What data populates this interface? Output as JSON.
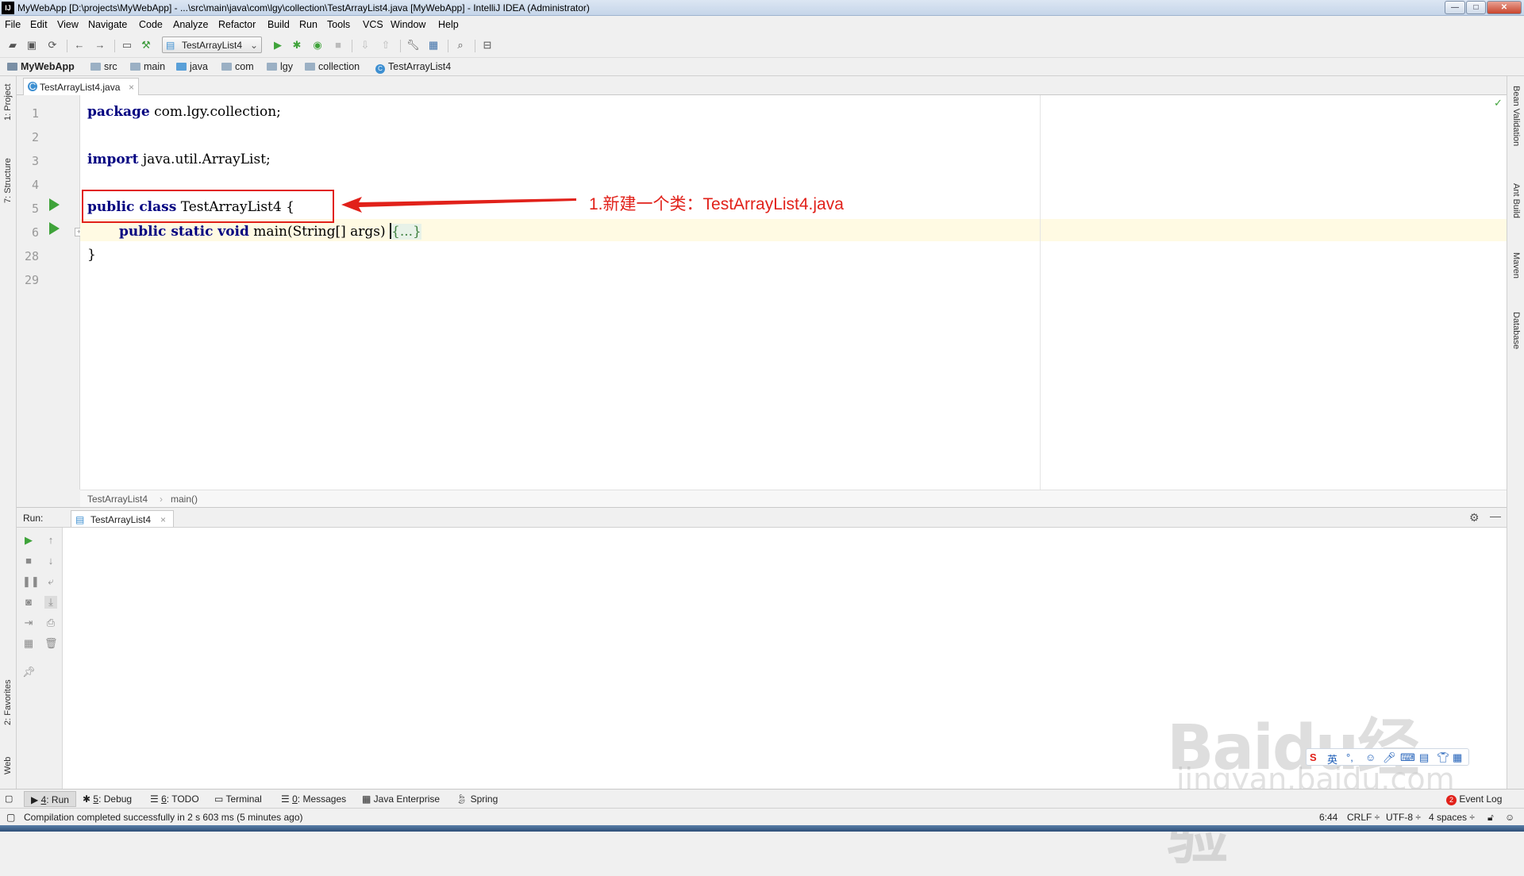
{
  "window": {
    "title": "MyWebApp [D:\\projects\\MyWebApp] - ...\\src\\main\\java\\com\\lgy\\collection\\TestArrayList4.java [MyWebApp] - IntelliJ IDEA (Administrator)",
    "app_icon": "IJ",
    "minimize": "—",
    "maximize": "□",
    "close": "✕"
  },
  "menu": [
    "File",
    "Edit",
    "View",
    "Navigate",
    "Code",
    "Analyze",
    "Refactor",
    "Build",
    "Run",
    "Tools",
    "VCS",
    "Window",
    "Help"
  ],
  "toolbar": {
    "run_config": "TestArrayList4",
    "icons": [
      "open-icon",
      "save-icon",
      "sync-icon",
      "back-icon",
      "forward-icon",
      "project-structure-icon",
      "build-icon",
      "run-icon",
      "debug-icon",
      "coverage-icon",
      "stop-icon",
      "vcs-update-icon",
      "vcs-commit-icon",
      "settings-icon",
      "sdk-icon",
      "search-icon",
      "terminal-icon"
    ]
  },
  "breadcrumbs": {
    "project": "MyWebApp",
    "items": [
      "src",
      "main",
      "java",
      "com",
      "lgy",
      "collection",
      "TestArrayList4"
    ]
  },
  "left_tool_windows": [
    "1: Project",
    "7: Structure",
    "2: Favorites",
    "Web"
  ],
  "right_tool_windows": [
    "Bean Validation",
    "Ant Build",
    "Maven",
    "Database"
  ],
  "editor": {
    "tab": "TestArrayList4.java",
    "lines": [
      {
        "num": "1",
        "kw": "package",
        "rest": " com.lgy.collection;"
      },
      {
        "num": "2",
        "kw": "",
        "rest": ""
      },
      {
        "num": "3",
        "kw": "import",
        "rest": " java.util.ArrayList;"
      },
      {
        "num": "4",
        "kw": "",
        "rest": ""
      },
      {
        "num": "5",
        "kw": "public class",
        "rest": " TestArrayList4 {"
      },
      {
        "num": "6",
        "kw": "public static void",
        "rest": " main(String[] args) ",
        "fold": "{...}"
      },
      {
        "num": "28",
        "kw": "",
        "rest": "}"
      },
      {
        "num": "29",
        "kw": "",
        "rest": ""
      }
    ],
    "crumb_class": "TestArrayList4",
    "crumb_method": "main()"
  },
  "annotation": {
    "text": "1.新建一个类：TestArrayList4.java",
    "color": "#e1211a"
  },
  "run_panel": {
    "label": "Run:",
    "tab": "TestArrayList4"
  },
  "bottom_tabs": [
    {
      "key": "4",
      "label": ": Run"
    },
    {
      "key": "5",
      "label": ": Debug"
    },
    {
      "key": "6",
      "label": ": TODO"
    },
    {
      "key": "",
      "label": "Terminal"
    },
    {
      "key": "0",
      "label": ": Messages"
    },
    {
      "key": "",
      "label": "Java Enterprise"
    },
    {
      "key": "",
      "label": "Spring"
    }
  ],
  "event_log": {
    "count": "2",
    "label": "Event Log"
  },
  "status": {
    "message": "Compilation completed successfully in 2 s 603 ms (5 minutes ago)",
    "position": "6:44",
    "line_sep": "CRLF ÷",
    "encoding": "UTF-8 ÷",
    "indent": "4 spaces ÷"
  },
  "watermark": {
    "logo": "Baidu经验",
    "url": "jingyan.baidu.com"
  },
  "ime": {
    "lang": "英"
  }
}
